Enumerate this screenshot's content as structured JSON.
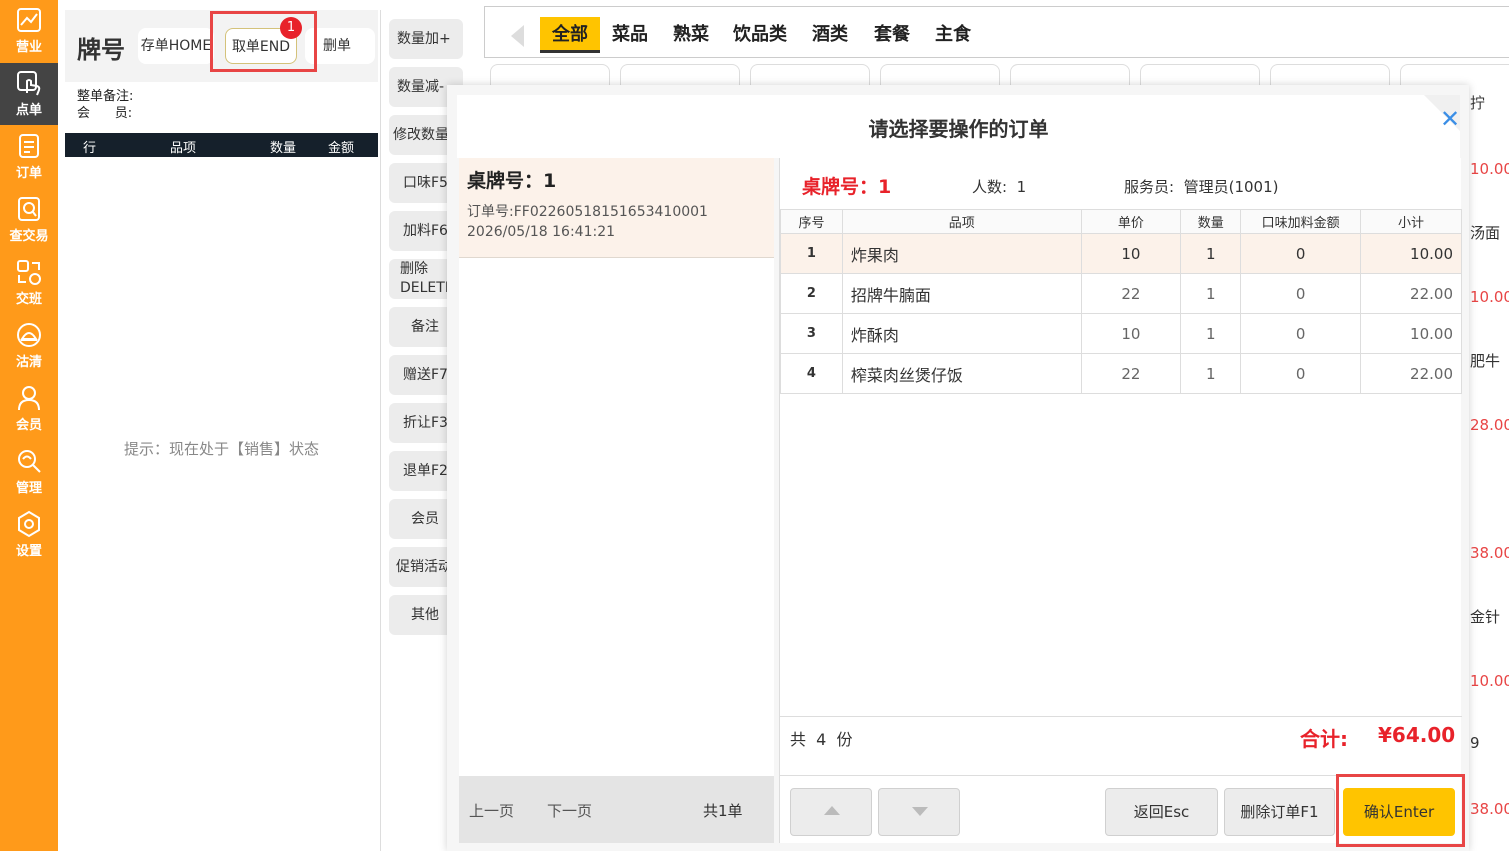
{
  "nav": {
    "items": [
      {
        "label": "营业",
        "icon": "chart-icon"
      },
      {
        "label": "点单",
        "icon": "tap-icon"
      },
      {
        "label": "订单",
        "icon": "document-icon"
      },
      {
        "label": "查交易",
        "icon": "search-document-icon"
      },
      {
        "label": "交班",
        "icon": "handover-icon"
      },
      {
        "label": "沽清",
        "icon": "cloche-icon"
      },
      {
        "label": "会员",
        "icon": "user-icon"
      },
      {
        "label": "管理",
        "icon": "wrench-icon"
      },
      {
        "label": "设置",
        "icon": "gear-icon"
      }
    ],
    "active_index": 1
  },
  "order_panel": {
    "title": "牌号",
    "save_label": "存单HOME",
    "take_label": "取单END",
    "take_badge": "1",
    "delete_label": "删单",
    "remark_label": "整单备注:",
    "member_label": "会      员:",
    "columns": [
      "行",
      "品项",
      "数量",
      "金额"
    ],
    "hint": "提示：现在处于【销售】状态"
  },
  "actions": [
    "数量加+",
    "数量减-",
    "修改数量",
    "口味F5",
    "加料F6",
    "删除\nDELETE",
    "备注",
    "赠送F7",
    "折让F3",
    "退单F2",
    "会员",
    "促销活动",
    "其他"
  ],
  "categories": {
    "items": [
      "全部",
      "菜品",
      "熟菜",
      "饮品类",
      "酒类",
      "套餐",
      "主食"
    ],
    "active_index": 0
  },
  "background_fragments": [
    {
      "text": "拧",
      "type": "name"
    },
    {
      "text": "10.00",
      "type": "price"
    },
    {
      "text": "汤面",
      "type": "name"
    },
    {
      "text": "10.00",
      "type": "price"
    },
    {
      "text": "肥牛",
      "type": "name"
    },
    {
      "text": "28.00",
      "type": "price"
    },
    {
      "text": "38.00",
      "type": "price"
    },
    {
      "text": "金针",
      "type": "name"
    },
    {
      "text": "10.00",
      "type": "price"
    },
    {
      "text": "9",
      "type": "name"
    },
    {
      "text": "38.00",
      "type": "price"
    }
  ],
  "modal": {
    "title": "请选择要操作的订单",
    "order_list": [
      {
        "table": "桌牌号：1",
        "order_no": "订单号:FF02260518151653410001",
        "time": "2026/05/18 16:41:21"
      }
    ],
    "pager": {
      "prev": "上一页",
      "next": "下一页",
      "total": "共1单"
    },
    "detail": {
      "table_label": "桌牌号：1",
      "people": "人数:  1",
      "waiter": "服务员:  管理员(1001)",
      "columns": [
        "序号",
        "品项",
        "单价",
        "数量",
        "口味加料金额",
        "小计"
      ],
      "rows": [
        [
          "1",
          "炸果肉",
          "10",
          "1",
          "0",
          "10.00"
        ],
        [
          "2",
          "招牌牛腩面",
          "22",
          "1",
          "0",
          "22.00"
        ],
        [
          "3",
          "炸酥肉",
          "10",
          "1",
          "0",
          "10.00"
        ],
        [
          "4",
          "榨菜肉丝煲仔饭",
          "22",
          "1",
          "0",
          "22.00"
        ]
      ],
      "count": "共  4  份",
      "total_label": "合计:",
      "total_value": "¥64.00"
    },
    "buttons": {
      "back": "返回Esc",
      "delete": "删除订单F1",
      "confirm": "确认Enter"
    }
  },
  "colors": {
    "accent": "#FF9A1A",
    "highlight": "#FFC400",
    "alert": "#E8222A",
    "nav_active": "#444444"
  }
}
